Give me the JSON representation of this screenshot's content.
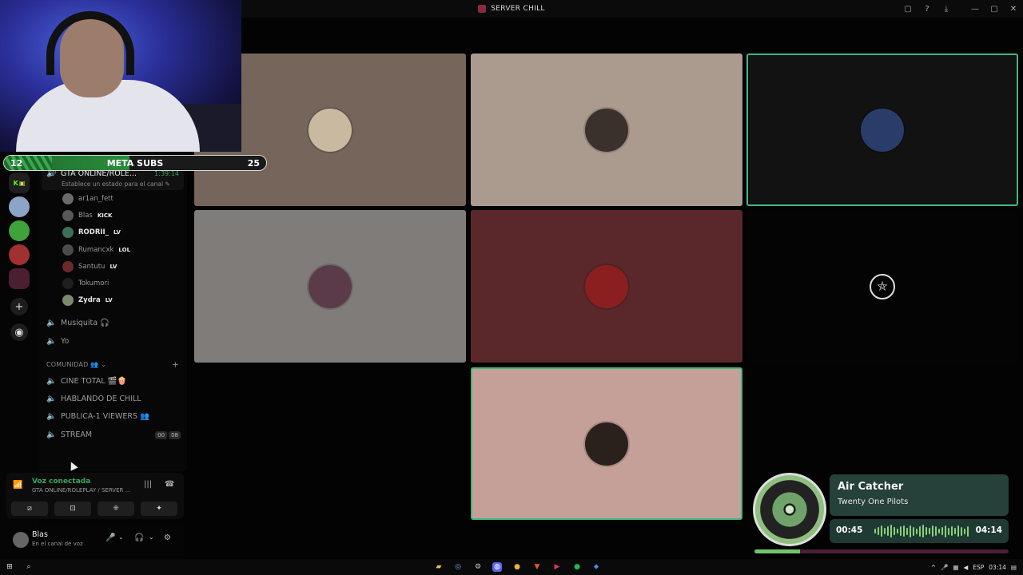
{
  "window": {
    "title": "SERVER CHILL"
  },
  "overlay": {
    "subs_current": "12",
    "subs_label": "META SUBS",
    "subs_goal": "25",
    "subs_progress": 0.48
  },
  "voice_channel": {
    "name": "GTA ONLINE/ROLE...",
    "elapsed": "1:39:14",
    "status_placeholder": "Establece un estado para el canal"
  },
  "members": [
    {
      "name": "ar1an_fett",
      "tag": "",
      "bold": false,
      "color": "#6b6b6b"
    },
    {
      "name": "Blas",
      "tag": "KICK",
      "bold": false,
      "color": "#585858"
    },
    {
      "name": "RODRII_",
      "tag": "LV",
      "bold": true,
      "color": "#3c6e5a"
    },
    {
      "name": "Rumancxk",
      "tag": "LOL",
      "bold": false,
      "color": "#4b4b4b"
    },
    {
      "name": "Santutu",
      "tag": "LV",
      "bold": false,
      "color": "#6a2a2a"
    },
    {
      "name": "Tokumori",
      "tag": "",
      "bold": false,
      "color": "#1f1f1f"
    },
    {
      "name": "Zydra",
      "tag": "LV",
      "bold": true,
      "color": "#7a8a6a"
    }
  ],
  "channels_top": [
    {
      "name": "Musiquita 🎧"
    },
    {
      "name": "Yo"
    }
  ],
  "category": {
    "name": "COMUNIDAD 👥 ⌄",
    "add": "+"
  },
  "channels_community": [
    {
      "name": "CINE TOTAL 🎬🍿"
    },
    {
      "name": "HABLANDO DE CHILL"
    },
    {
      "name": "PUBLICA-1 VIEWERS 👥"
    },
    {
      "name": "STREAM"
    }
  ],
  "stream_pills": [
    "00",
    "08"
  ],
  "voice_panel": {
    "status": "Voz conectada",
    "channel": "GTA ONLINE/ROLEPLAY / SERVER ..."
  },
  "user_panel": {
    "name": "Blas",
    "status": "En el canal de voz"
  },
  "music": {
    "title": "Air Catcher",
    "artist": "Twenty One Pilots",
    "current": "00:45",
    "total": "04:14",
    "progress": 0.18
  },
  "taskbar": {
    "lang": "ESP",
    "time": "03:14"
  },
  "colors": {
    "speaking": "#43b581",
    "online": "#3ba55c",
    "music_box": "#26403a"
  },
  "tiles": [
    {
      "name": "tile-1",
      "bg": "#76655b",
      "avatar": "#c9b9a0",
      "speaking": false
    },
    {
      "name": "tile-2",
      "bg": "#ab9b8f",
      "avatar": "#3a302c",
      "speaking": false
    },
    {
      "name": "tile-3",
      "bg": "#121212",
      "avatar": "#2a3d6a",
      "speaking": true
    },
    {
      "name": "tile-4",
      "bg": "#807c79",
      "avatar": "#5b3b4a",
      "speaking": false
    },
    {
      "name": "tile-5",
      "bg": "#5a282b",
      "avatar": "#8b1f1f",
      "speaking": false
    },
    {
      "name": "tile-6",
      "bg": "#040404",
      "avatar": "",
      "speaking": false
    },
    {
      "name": "tile-7",
      "bg": "#c5a098",
      "avatar": "#2a211d",
      "speaking": true
    }
  ]
}
